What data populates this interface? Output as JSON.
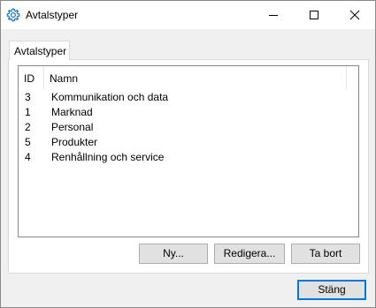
{
  "window": {
    "title": "Avtalstyper"
  },
  "tabs": [
    {
      "label": "Avtalstyper"
    }
  ],
  "list": {
    "columns": [
      {
        "label": "ID"
      },
      {
        "label": "Namn"
      }
    ],
    "rows": [
      {
        "id": "3",
        "name": "Kommunikation och data"
      },
      {
        "id": "1",
        "name": "Marknad"
      },
      {
        "id": "2",
        "name": "Personal"
      },
      {
        "id": "5",
        "name": "Produkter"
      },
      {
        "id": "4",
        "name": "Renhållning och service"
      }
    ]
  },
  "buttons": {
    "new": "Ny...",
    "edit": "Redigera...",
    "delete": "Ta bort",
    "close": "Stäng"
  },
  "icons": {
    "app": "gear-icon",
    "minimize": "minimize-icon",
    "maximize": "maximize-icon",
    "close": "close-icon"
  },
  "colors": {
    "accent": "#0078d7",
    "app_icon": "#1e7ac8"
  }
}
